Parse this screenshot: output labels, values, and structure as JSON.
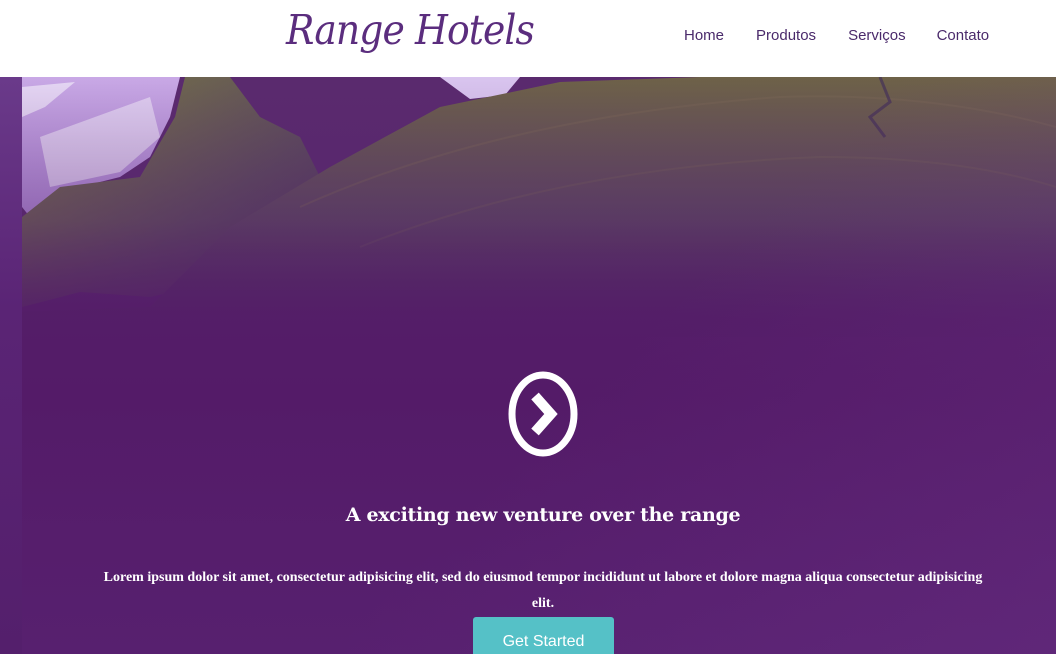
{
  "navbar": {
    "brand": "Range Hotels",
    "links": [
      {
        "label": "Home"
      },
      {
        "label": "Produtos"
      },
      {
        "label": "Serviços"
      },
      {
        "label": "Contato"
      }
    ]
  },
  "hero": {
    "icon": "circle-chevron-right-icon",
    "headline": "A exciting new venture over the range",
    "body": "Lorem ipsum dolor sit amet, consectetur adipisicing elit, sed do eiusmod tempor incididunt ut labore et dolore magna aliqua consectetur adipisicing elit.",
    "cta_label": "Get Started"
  },
  "colors": {
    "brand": "#5b2d7e",
    "overlay": "#551c6a",
    "accent": "#55c1c7"
  }
}
